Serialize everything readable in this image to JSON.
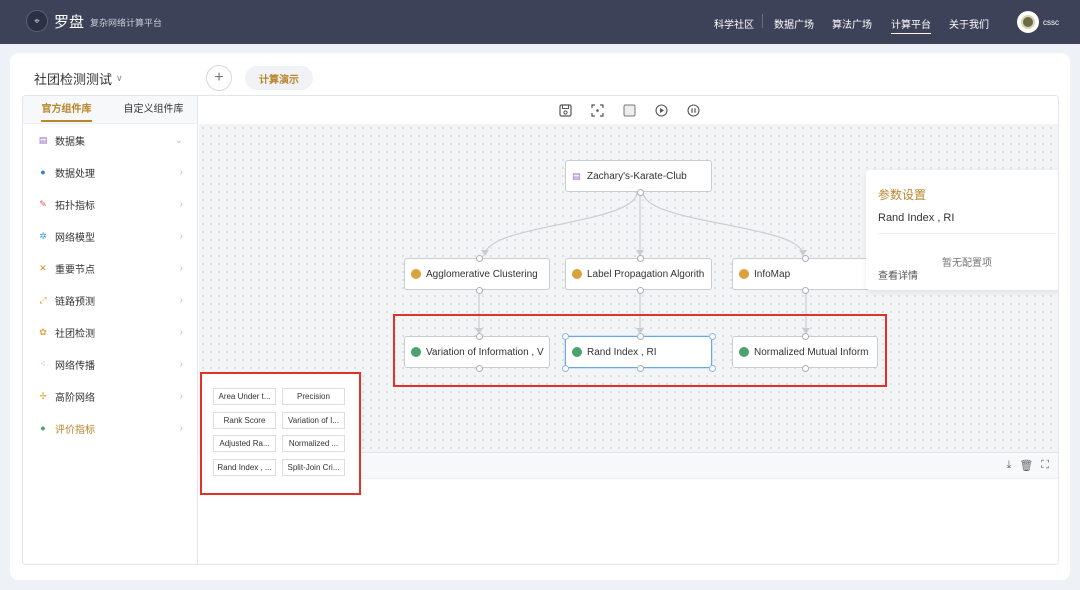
{
  "header": {
    "brand": "罗盘",
    "brand_sub": "复杂网络计算平台",
    "nav": [
      "科学社区",
      "数据广场",
      "算法广场",
      "计算平台",
      "关于我们"
    ],
    "active_nav": "计算平台",
    "user": "cssc"
  },
  "project": {
    "title": "社团检测测试",
    "add": "+",
    "compute_button": "计算演示"
  },
  "sidebar": {
    "tabs": [
      "官方组件库",
      "自定义组件库"
    ],
    "items": [
      {
        "label": "数据集",
        "icon": "dataset-icon"
      },
      {
        "label": "数据处理",
        "icon": "data-processing-icon"
      },
      {
        "label": "拓扑指标",
        "icon": "topology-icon"
      },
      {
        "label": "网络模型",
        "icon": "network-model-icon"
      },
      {
        "label": "重要节点",
        "icon": "important-node-icon"
      },
      {
        "label": "链路预测",
        "icon": "link-prediction-icon"
      },
      {
        "label": "社团检测",
        "icon": "community-detection-icon"
      },
      {
        "label": "网络传播",
        "icon": "network-spread-icon"
      },
      {
        "label": "高阶网络",
        "icon": "higher-order-icon"
      },
      {
        "label": "评价指标",
        "icon": "evaluation-icon"
      }
    ]
  },
  "canvas": {
    "nodes": {
      "dataset": "Zachary's-Karate-Club",
      "algo1": "Agglomerative Clustering",
      "algo2": "Label Propagation Algorith",
      "algo3": "InfoMap",
      "metric1": "Variation of Information , V",
      "metric2": "Rand Index , RI",
      "metric3": "Normalized Mutual Inform"
    }
  },
  "params": {
    "title": "参数设置",
    "value": "Rand Index , RI",
    "empty": "暂无配置项",
    "detail": "查看详情"
  },
  "metrics_list": [
    "Area Under t...",
    "Precision",
    "Rank Score",
    "Variation of I...",
    "Adjusted Ra...",
    "Normalized ...",
    "Rand Index , ...",
    "Split-Join Cri..."
  ],
  "colors": {
    "accent": "#b8862d",
    "topbar": "#3d4258",
    "highlight": "#e0312a"
  }
}
